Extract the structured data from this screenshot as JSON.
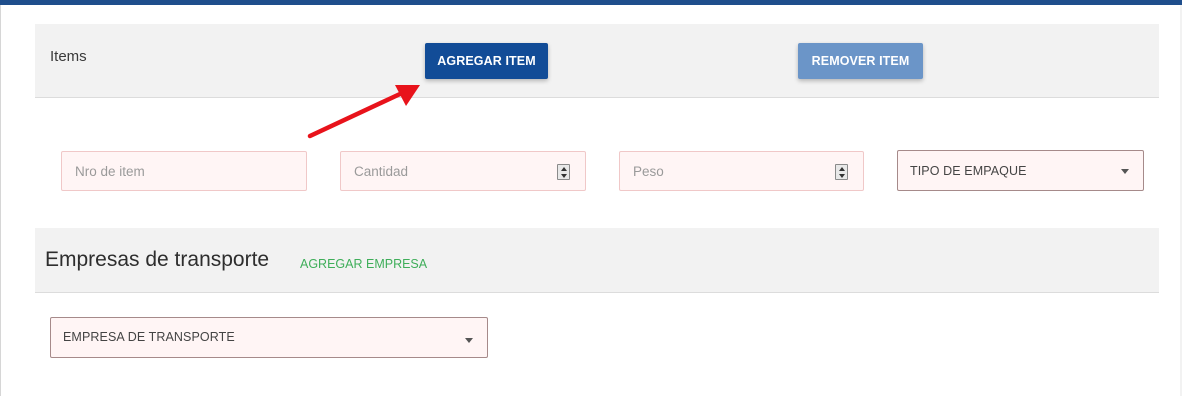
{
  "items_section": {
    "title": "Items",
    "add_button_label": "AGREGAR ITEM",
    "remove_button_label": "REMOVER ITEM",
    "fields": {
      "nro_placeholder": "Nro de item",
      "cantidad_placeholder": "Cantidad",
      "peso_placeholder": "Peso",
      "tipo_empaque_selected": "TIPO DE EMPAQUE"
    }
  },
  "transport_section": {
    "title": "Empresas de transporte",
    "add_link_label": "AGREGAR EMPRESA",
    "empresa_selected": "EMPRESA DE TRANSPORTE"
  },
  "colors": {
    "top_bar": "#1f4e8c",
    "primary_button": "#124c97",
    "secondary_button": "#6b95c8",
    "link_green": "#3fae5a",
    "annotation_arrow": "#e8131b",
    "field_background": "#fff5f5"
  },
  "icons": {
    "spinner": "number-spinner-icon",
    "dropdown": "caret-down-icon",
    "annotation": "red-arrow-icon"
  }
}
